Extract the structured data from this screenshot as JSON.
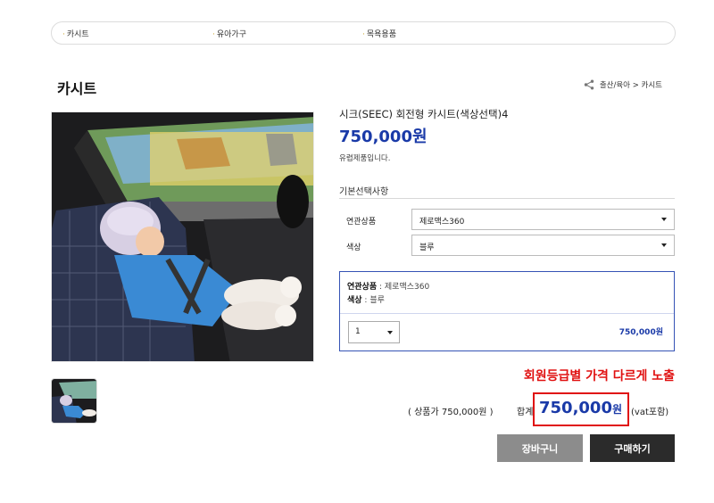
{
  "category_nav": {
    "items": [
      {
        "label": "카시트"
      },
      {
        "label": "유아가구"
      },
      {
        "label": "목욕용품"
      }
    ]
  },
  "page_title": "카시트",
  "breadcrumb": {
    "text": "출산/육아 > 카시트",
    "icon": "share-icon"
  },
  "product": {
    "name": "시크(SEEC) 회전형 카시트(색상선택)4",
    "price": "750,000원",
    "shipping": "유렵제품입니다."
  },
  "options": {
    "title": "기본선택사항",
    "related_label": "연관상품",
    "related_value": "제로맥스360",
    "color_label": "색상",
    "color_value": "블루"
  },
  "selection": {
    "related_key": "연관상품",
    "related_val": " : 제로맥스360",
    "color_key": "색상",
    "color_val": " : 블루",
    "qty": "1",
    "price": "750,000원"
  },
  "note": "회원등급별 가격 다르게 노출",
  "totals": {
    "subtotal": "( 상품가 750,000원 )",
    "label": "합계",
    "amount": "750,000",
    "unit": "원",
    "vat": "(vat포함)"
  },
  "buttons": {
    "cart": "장바구니",
    "buy": "구매하기"
  },
  "colors": {
    "accent_blue": "#1a3aa8",
    "highlight_red": "#e01010"
  }
}
